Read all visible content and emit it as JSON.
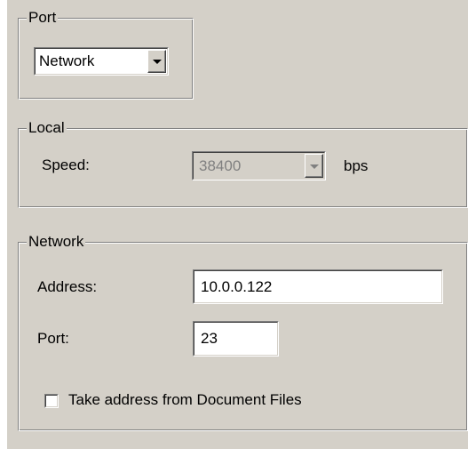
{
  "port_group": {
    "legend": "Port",
    "port_select": {
      "value": "Network"
    }
  },
  "local_group": {
    "legend": "Local",
    "speed_label": "Speed:",
    "speed_select": {
      "value": "38400",
      "enabled": false
    },
    "speed_unit": "bps"
  },
  "network_group": {
    "legend": "Network",
    "address_label": "Address:",
    "address_value": "10.0.0.122",
    "port_label": "Port:",
    "port_value": "23",
    "take_address_checkbox": {
      "label": "Take address from Document Files",
      "checked": false
    }
  },
  "icons": {
    "dropdown_arrow": "chevron-down-icon"
  }
}
